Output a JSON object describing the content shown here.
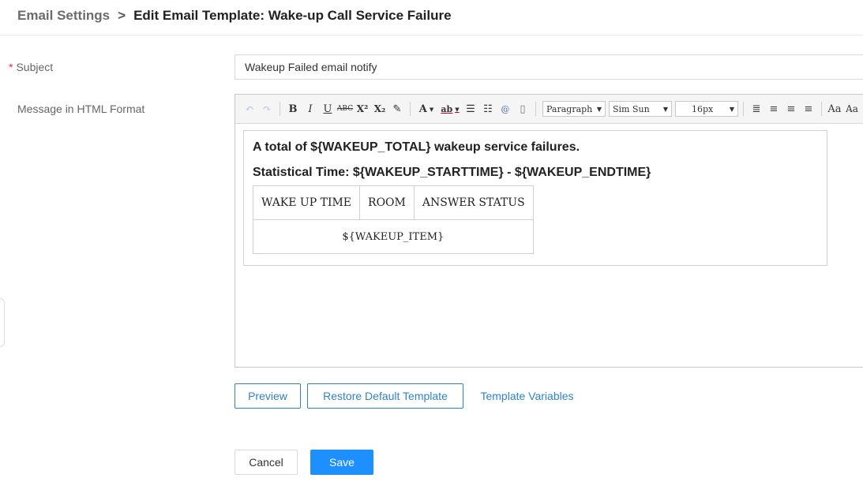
{
  "breadcrumb": {
    "parent": "Email Settings",
    "separator": ">",
    "current": "Edit Email Template: Wake-up Call Service Failure"
  },
  "form": {
    "subject_label": "Subject",
    "required_mark": "*",
    "subject_value": "Wakeup Failed email notify",
    "message_label": "Message in HTML Format"
  },
  "toolbar": {
    "undo": "↶",
    "redo": "↷",
    "bold": "B",
    "italic": "I",
    "underline": "U",
    "strike": "ABC",
    "superscript": "X²",
    "subscript": "X₂",
    "eraser": "✎",
    "font_color": "A",
    "highlight": "ab",
    "ordered_list": "☰",
    "unordered_list": "☷",
    "anchor": "@",
    "page": "▯",
    "paragraph": "Paragraph",
    "font_family": "Sim Sun",
    "font_size": "16px",
    "align_justify": "≣",
    "align_left": "≡",
    "align_center": "≡",
    "align_right": "≡",
    "font_up": "Aa",
    "font_down": "Aa"
  },
  "editor_content": {
    "line1": "A total of ${WAKEUP_TOTAL} wakeup service failures.",
    "line2": "Statistical Time: ${WAKEUP_STARTTIME} - ${WAKEUP_ENDTIME}",
    "table_headers": [
      "WAKE UP TIME",
      "ROOM",
      "ANSWER STATUS"
    ],
    "table_row": "${WAKEUP_ITEM}"
  },
  "actions": {
    "preview": "Preview",
    "restore": "Restore Default Template",
    "variables": "Template Variables",
    "cancel": "Cancel",
    "save": "Save"
  },
  "colors": {
    "primary": "#1e8fff",
    "link": "#2f84c7",
    "required": "#e53935"
  }
}
